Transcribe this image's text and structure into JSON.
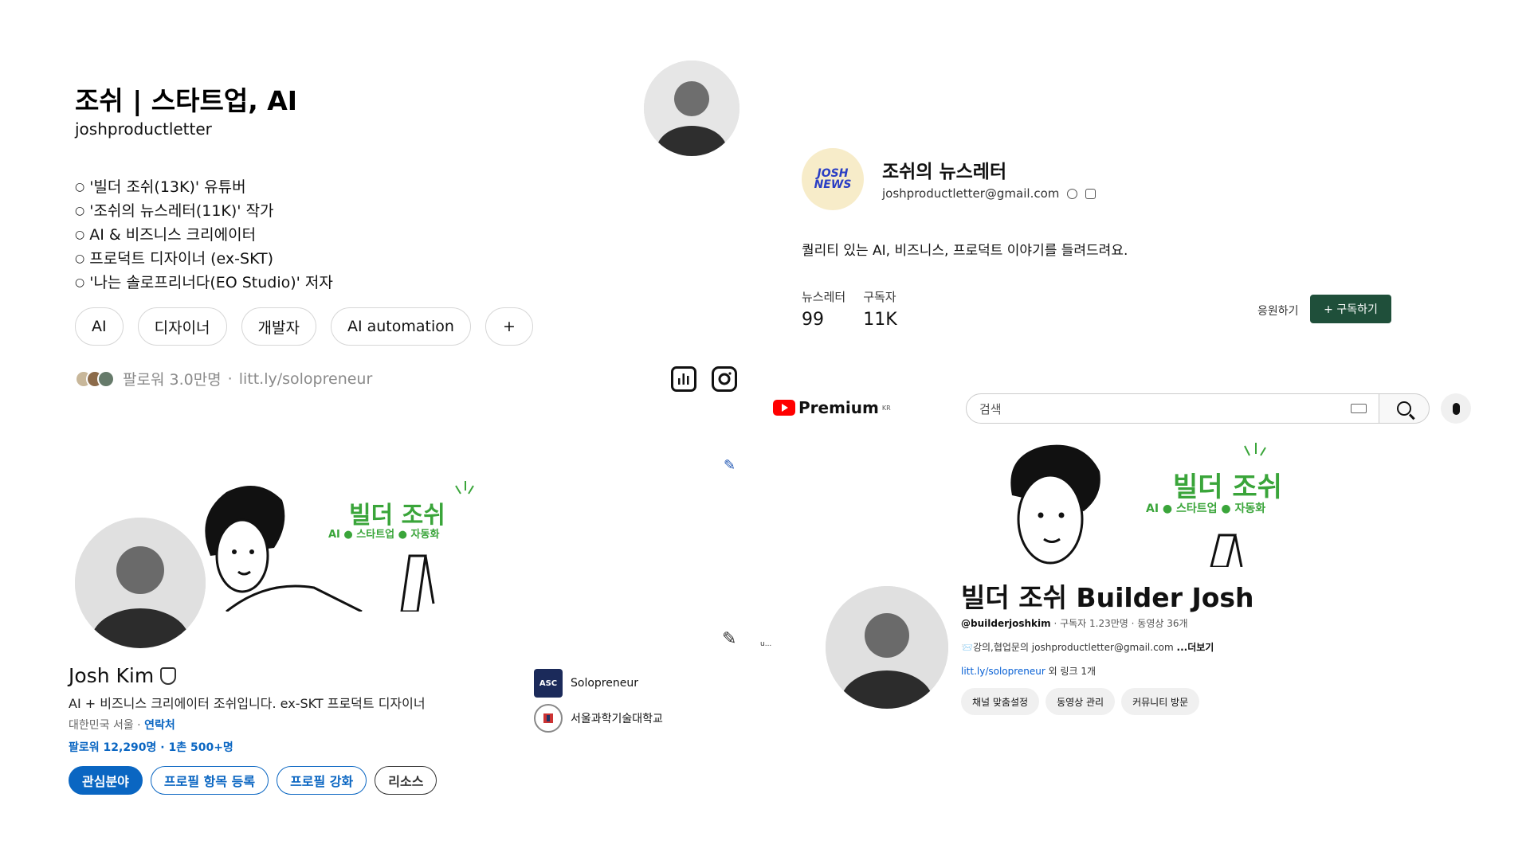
{
  "threads": {
    "title": "조쉬 | 스타트업, AI",
    "handle": "joshproductletter",
    "bio": [
      "'빌더 조쉬(13K)' 유튜버",
      "'조쉬의 뉴스레터(11K)' 작가",
      "AI & 비즈니스 크리에이터",
      "프로덕트 디자이너 (ex-SKT)",
      "'나는 솔로프리너다(EO Studio)' 저자"
    ],
    "tags": [
      "AI",
      "디자이너",
      "개발자",
      "AI automation",
      "+"
    ],
    "followers": "팔로워 3.0만명",
    "separator": "·",
    "link": "litt.ly/solopreneur"
  },
  "newsletter": {
    "logo_line1": "JOSH",
    "logo_line2": "NEWS",
    "title": "조쉬의 뉴스레터",
    "email": "joshproductletter@gmail.com",
    "description": "퀄리티 있는 AI, 비즈니스, 프로덕트 이야기를 들려드려요.",
    "stats": [
      {
        "label": "뉴스레터",
        "value": "99"
      },
      {
        "label": "구독자",
        "value": "11K"
      }
    ],
    "support_label": "응원하기",
    "subscribe_label": "+ 구독하기"
  },
  "linkedin": {
    "banner_title": "빌더 조쉬",
    "banner_subtitle": "AI ● 스타트업 ● 자동화",
    "name": "Josh Kim",
    "headline": "AI + 비즈니스 크리에이터 조쉬입니다. ex-SKT 프로덕트 디자이너",
    "location": "대한민국 서울 · ",
    "contact_link": "연락처",
    "counts": "팔로워 12,290명 · 1촌 500+명",
    "more_label": "u...",
    "buttons": [
      "관심분야",
      "프로필 항목 등록",
      "프로필 강화",
      "리소스"
    ],
    "orgs": [
      {
        "name": "Solopreneur",
        "logo_text": "ASC"
      },
      {
        "name": "서울과학기술대학교",
        "logo_text": ""
      }
    ]
  },
  "youtube": {
    "logo_text": "Premium",
    "region": "KR",
    "search_placeholder": "검색",
    "banner_title": "빌더 조쉬",
    "banner_subtitle": "AI ● 스타트업 ● 자동화",
    "channel_name": "빌더 조쉬 Builder Josh",
    "handle": "@builderjoshkim",
    "meta_rest": " · 구독자 1.23만명 · 동영상 36개",
    "description": "📨강의,협업문의 joshproductletter@gmail.com ",
    "more_label": "...더보기",
    "link": "litt.ly/solopreneur",
    "link_rest": " 외 링크 1개",
    "buttons": [
      "채널 맞춤설정",
      "동영상 관리",
      "커뮤니티 방문"
    ]
  },
  "colors": {
    "banner_green": "#3aa53a",
    "linkedin_blue": "#0a66c2",
    "newsletter_green": "#1f4f3a",
    "youtube_red": "#ff0000"
  }
}
